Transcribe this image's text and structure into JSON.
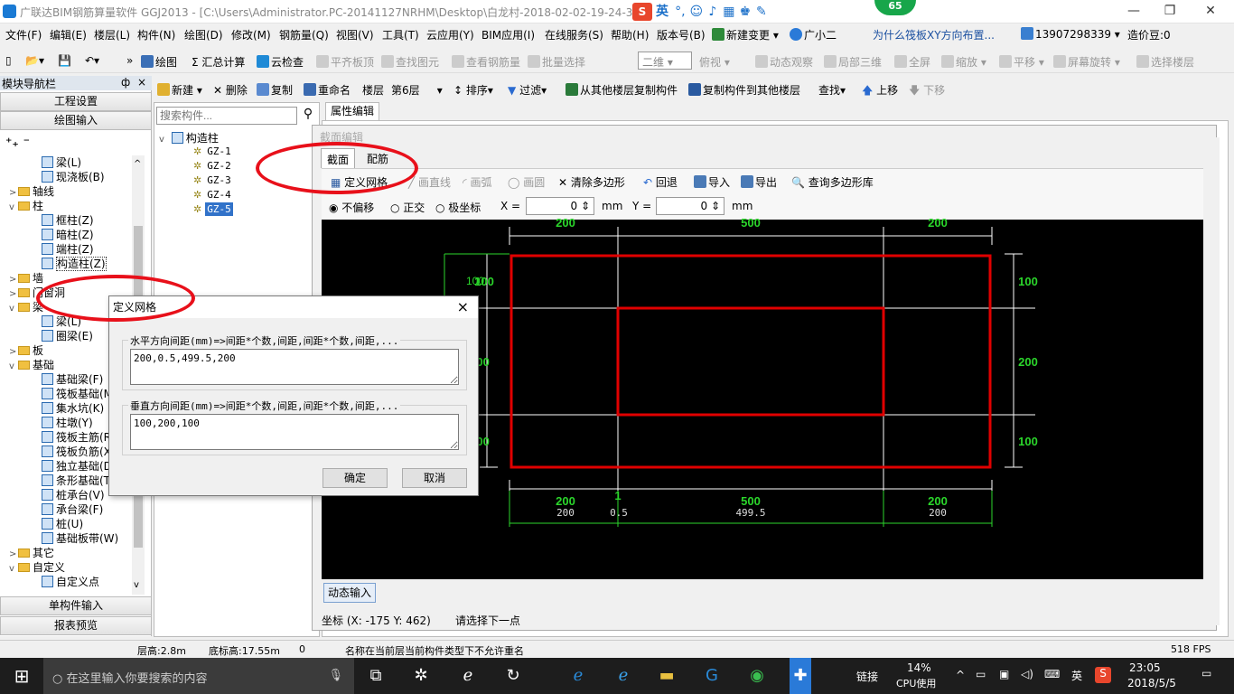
{
  "app": {
    "title": "广联达BIM钢筋算量软件 GGJ2013 - [C:\\Users\\Administrator.PC-20141127NRHM\\Desktop\\白龙村-2018-02-02-19-24-35"
  },
  "ime": {
    "logo": "S",
    "lang": "英"
  },
  "badge": {
    "count": "65"
  },
  "menu": {
    "items": [
      "文件(F)",
      "编辑(E)",
      "楼层(L)",
      "构件(N)",
      "绘图(D)",
      "修改(M)",
      "钢筋量(Q)",
      "视图(V)",
      "工具(T)",
      "云应用(Y)",
      "BIM应用(I)",
      "在线服务(S)",
      "帮助(H)",
      "版本号(B)",
      "新建变更",
      "广小二"
    ],
    "news": "为什么筏板XY方向布置...",
    "phone": "13907298339",
    "price": "造价豆:0"
  },
  "toolbar": {
    "draw": "绘图",
    "sum": "汇总计算",
    "cloud_check": "云检查",
    "flat_top": "平齐板顶",
    "find_elem": "查找图元",
    "view_rebar": "查看钢筋量",
    "batch_sel": "批量选择",
    "view_mode": "二维",
    "top_view": "俯视",
    "dyn_view": "动态观察",
    "local_3d": "局部三维",
    "full": "全屏",
    "zoom": "缩放",
    "pan": "平移",
    "rotate": "屏幕旋转",
    "sel_floor": "选择楼层"
  },
  "toolbar2": {
    "new": "新建",
    "delete": "删除",
    "copy": "复制",
    "rename": "重命名",
    "floor_label": "楼层",
    "floor_value": "第6层",
    "sort": "排序",
    "filter": "过滤",
    "copy_from": "从其他楼层复制构件",
    "copy_to": "复制构件到其他楼层",
    "find": "查找",
    "up": "上移",
    "down": "下移"
  },
  "nav": {
    "title": "模块导航栏",
    "pin": "ф",
    "close": "×",
    "project_settings": "工程设置",
    "draw_input": "绘图输入",
    "single_input": "单构件输入",
    "report": "报表预览"
  },
  "tree": [
    {
      "label": "梁(L)",
      "level": 2,
      "type": "item"
    },
    {
      "label": "现浇板(B)",
      "level": 2,
      "type": "item"
    },
    {
      "label": "轴线",
      "level": 1,
      "type": "folder",
      "exp": ">"
    },
    {
      "label": "柱",
      "level": 1,
      "type": "folder",
      "exp": "v"
    },
    {
      "label": "框柱(Z)",
      "level": 2,
      "type": "item"
    },
    {
      "label": "暗柱(Z)",
      "level": 2,
      "type": "item"
    },
    {
      "label": "端柱(Z)",
      "level": 2,
      "type": "item"
    },
    {
      "label": "构造柱(Z)",
      "level": 2,
      "type": "item",
      "selected": true
    },
    {
      "label": "墙",
      "level": 1,
      "type": "folder",
      "exp": ">"
    },
    {
      "label": "门窗洞",
      "level": 1,
      "type": "folder",
      "exp": ">"
    },
    {
      "label": "梁",
      "level": 1,
      "type": "folder",
      "exp": "v"
    },
    {
      "label": "梁(L)",
      "level": 2,
      "type": "item"
    },
    {
      "label": "圈梁(E)",
      "level": 2,
      "type": "item"
    },
    {
      "label": "板",
      "level": 1,
      "type": "folder",
      "exp": ">"
    },
    {
      "label": "基础",
      "level": 1,
      "type": "folder",
      "exp": "v"
    },
    {
      "label": "基础梁(F)",
      "level": 2,
      "type": "item"
    },
    {
      "label": "筏板基础(M)",
      "level": 2,
      "type": "item"
    },
    {
      "label": "集水坑(K)",
      "level": 2,
      "type": "item"
    },
    {
      "label": "柱墩(Y)",
      "level": 2,
      "type": "item"
    },
    {
      "label": "筏板主筋(R)",
      "level": 2,
      "type": "item"
    },
    {
      "label": "筏板负筋(X)",
      "level": 2,
      "type": "item"
    },
    {
      "label": "独立基础(D)",
      "level": 2,
      "type": "item"
    },
    {
      "label": "条形基础(T)",
      "level": 2,
      "type": "item"
    },
    {
      "label": "桩承台(V)",
      "level": 2,
      "type": "item"
    },
    {
      "label": "承台梁(F)",
      "level": 2,
      "type": "item"
    },
    {
      "label": "桩(U)",
      "level": 2,
      "type": "item"
    },
    {
      "label": "基础板带(W)",
      "level": 2,
      "type": "item"
    },
    {
      "label": "其它",
      "level": 1,
      "type": "folder",
      "exp": ">"
    },
    {
      "label": "自定义",
      "level": 1,
      "type": "folder",
      "exp": "v"
    },
    {
      "label": "自定义点",
      "level": 2,
      "type": "item"
    }
  ],
  "components": {
    "search_placeholder": "搜索构件...",
    "root": "构造柱",
    "items": [
      "GZ-1",
      "GZ-2",
      "GZ-3",
      "GZ-4",
      "GZ-5"
    ],
    "selected": "GZ-5"
  },
  "prop_tab": "属性编辑",
  "section_editor": {
    "title": "截面编辑",
    "tabs": [
      "截面",
      "配筋"
    ],
    "tools": {
      "define_grid": "定义网格",
      "line": "画直线",
      "arc": "画弧",
      "circle": "画圆",
      "clear": "清除多边形",
      "undo": "回退",
      "import": "导入",
      "export": "导出",
      "query": "查询多边形库"
    },
    "offset": {
      "none": "不偏移",
      "ortho": "正交",
      "polar": "极坐标",
      "x_label": "X =",
      "x_value": "0",
      "unit": "mm",
      "y_label": "Y =",
      "y_value": "0"
    }
  },
  "canvas": {
    "top_dims": [
      "200",
      "500",
      "200"
    ],
    "left_dims": [
      "100",
      "100",
      "100",
      "200"
    ],
    "right_dims": [
      "100",
      "200",
      "100"
    ],
    "bottom_dims": [
      "200",
      "1",
      "500",
      "200"
    ],
    "bottom_sub": [
      "200",
      "0.5",
      "499.5",
      "200"
    ]
  },
  "dyn_input": "动态输入",
  "status": {
    "coord": "坐标 (X: -175 Y: 462)",
    "prompt": "请选择下一点"
  },
  "bottom": {
    "floor_h": "层高:2.8m",
    "base_h": "底标高:17.55m",
    "zero": "0",
    "msg": "名称在当前层当前构件类型下不允许重名",
    "fps": "518 FPS"
  },
  "dialog": {
    "title": "定义网格",
    "h_label": "水平方向间距(mm)=>间距*个数,间距,间距*个数,间距,...",
    "h_value": "200,0.5,499.5,200",
    "v_label": "垂直方向间距(mm)=>间距*个数,间距,间距*个数,间距,...",
    "v_value": "100,200,100",
    "ok": "确定",
    "cancel": "取消",
    "close": "×"
  },
  "taskbar": {
    "search": "在这里输入你要搜索的内容",
    "link": "链接",
    "cpu_pct": "14%",
    "cpu_label": "CPU使用",
    "ime": "英",
    "time": "23:05",
    "date": "2018/5/5"
  },
  "colors": {
    "grid": "#ffffff",
    "section": "#e00000",
    "dim": "#2bd62b",
    "ellipse": "#e8101a"
  }
}
